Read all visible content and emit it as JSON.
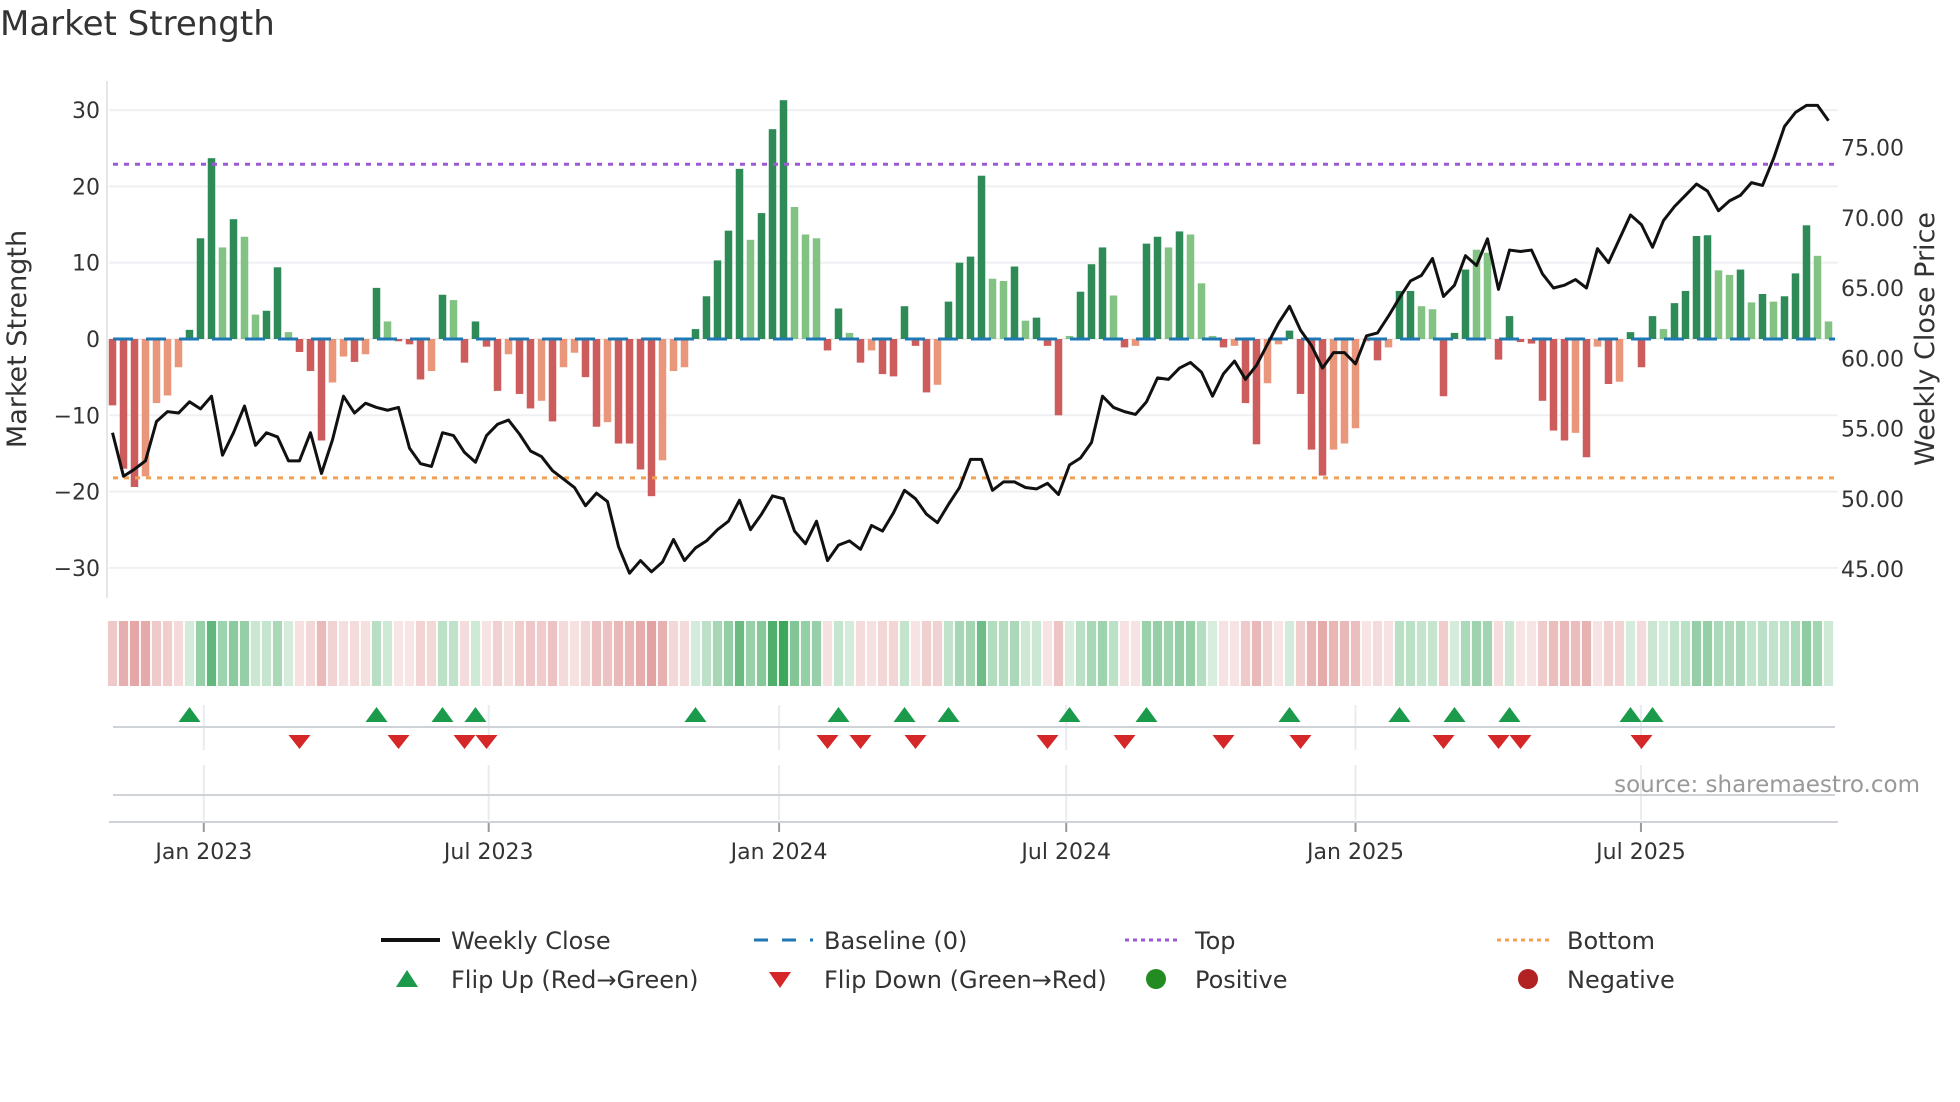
{
  "chart_data": {
    "type": "bar",
    "title": "Market Strength",
    "ylabel": "Market Strength",
    "y2label": "Weekly Close Price",
    "source": "source: sharemaestro.com",
    "ylim": [
      -33.8,
      33.8
    ],
    "y2lim": [
      42.9,
      79.7
    ],
    "yticks": [
      {
        "v": 30,
        "label": "30"
      },
      {
        "v": 20,
        "label": "20"
      },
      {
        "v": 10,
        "label": "10"
      },
      {
        "v": 0,
        "label": "0"
      },
      {
        "v": -10,
        "label": "−10"
      },
      {
        "v": -20,
        "label": "−20"
      },
      {
        "v": -30,
        "label": "−30"
      }
    ],
    "y2ticks": [
      {
        "v": 75,
        "label": "75.00"
      },
      {
        "v": 70,
        "label": "70.00"
      },
      {
        "v": 65,
        "label": "65.00"
      },
      {
        "v": 60,
        "label": "60.00"
      },
      {
        "v": 55,
        "label": "55.00"
      },
      {
        "v": 50,
        "label": "50.00"
      },
      {
        "v": 45,
        "label": "45.00"
      }
    ],
    "xticks": [
      {
        "week": 8.3,
        "label": "Jan 2023"
      },
      {
        "week": 34.2,
        "label": "Jul 2023"
      },
      {
        "week": 60.6,
        "label": "Jan 2024"
      },
      {
        "week": 86.7,
        "label": "Jul 2024"
      },
      {
        "week": 113.0,
        "label": "Jan 2025"
      },
      {
        "week": 138.95,
        "label": "Jul 2025"
      }
    ],
    "top": 22.9,
    "bottom": -18.2,
    "baseline": 0,
    "colors": {
      "G": "#2e8b57",
      "g": "#82c383",
      "R": "#cd5c5c",
      "r": "#e9967a",
      "top": "#9b59d6",
      "bottom": "#f0a050",
      "baseline": "#1f77b4",
      "close": "#111111",
      "flip_up": "#1a9a4a",
      "flip_down": "#d62728",
      "positive": "#228b22",
      "negative": "#b22222"
    },
    "bar_shade": "RRRrrrrGGGgGggGGgRRRrrRrGgRRRrGgRGRRrRRrRrrRRrRRRRrrrGGGGGgGGGgggRGgRrRRGRRrGGGGggGgGRRgGGGgRrGGgGgggRrRRrrGRRRrrrrRrGGggRGGggRGRRRRRrRrRrGRGgGGGGggGgGgGGGgg",
    "strength": [
      -8.7,
      -17,
      -19.4,
      -18,
      -8.4,
      -7.4,
      -3.7,
      1.2,
      13.2,
      23.7,
      12,
      15.7,
      13.4,
      3.2,
      3.7,
      9.4,
      0.9,
      -1.7,
      -4.2,
      -13.3,
      -5.7,
      -2.3,
      -3,
      -2,
      6.7,
      2.3,
      -0.3,
      -0.7,
      -5.3,
      -4.2,
      5.8,
      5.1,
      -3.1,
      2.3,
      -1,
      -6.8,
      -2,
      -7.2,
      -9.1,
      -8.1,
      -10.8,
      -3.7,
      -1.8,
      -5,
      -11.5,
      -10.9,
      -13.7,
      -13.7,
      -17.1,
      -20.6,
      -15.9,
      -4.2,
      -3.7,
      1.3,
      5.6,
      10.3,
      14.2,
      22.3,
      13,
      16.5,
      27.5,
      31.3,
      17.3,
      13.7,
      13.2,
      -1.5,
      4,
      0.8,
      -3.1,
      -1.5,
      -4.6,
      -4.9,
      4.3,
      -0.9,
      -7,
      -6,
      4.9,
      10,
      10.8,
      21.4,
      7.9,
      7.6,
      9.5,
      2.4,
      2.8,
      -0.9,
      -10,
      0.4,
      6.2,
      9.8,
      12,
      5.7,
      -1.1,
      -0.9,
      12.5,
      13.4,
      12,
      14.1,
      13.7,
      7.3,
      0.4,
      -1.1,
      -0.9,
      -8.4,
      -13.8,
      -5.8,
      -0.7,
      1.1,
      -7.2,
      -14.5,
      -17.9,
      -14.5,
      -13.7,
      -11.7,
      -0.3,
      -2.8,
      -1.1,
      6.3,
      6.3,
      4.3,
      3.9,
      -7.5,
      0.8,
      9.1,
      11.7,
      11.3,
      -2.7,
      3,
      -0.4,
      -0.6,
      -8.1,
      -12,
      -13.3,
      -12.3,
      -15.5,
      -1,
      -5.9,
      -5.6,
      0.9,
      -3.7,
      3,
      1.3,
      4.7,
      6.3,
      13.5,
      13.6,
      9,
      8.4,
      9.1,
      4.8,
      5.9,
      4.9,
      5.6,
      8.6,
      14.9,
      10.9,
      2.3
    ],
    "close": [
      54.7,
      51.6,
      52.1,
      52.7,
      55.5,
      56.2,
      56.1,
      56.9,
      56.4,
      57.3,
      53.1,
      54.7,
      56.6,
      53.8,
      54.7,
      54.4,
      52.7,
      52.7,
      54.7,
      51.8,
      54.2,
      57.3,
      56.1,
      56.8,
      56.5,
      56.3,
      56.5,
      53.6,
      52.5,
      52.3,
      54.7,
      54.5,
      53.3,
      52.6,
      54.5,
      55.3,
      55.6,
      54.6,
      53.4,
      53,
      52,
      51.4,
      50.8,
      49.5,
      50.4,
      49.8,
      46.6,
      44.7,
      45.6,
      44.8,
      45.5,
      47.1,
      45.6,
      46.5,
      47,
      47.8,
      48.4,
      49.9,
      47.8,
      48.9,
      50.2,
      50,
      47.7,
      46.8,
      48.4,
      45.6,
      46.7,
      47,
      46.4,
      48.1,
      47.7,
      49,
      50.6,
      50,
      48.9,
      48.3,
      49.6,
      50.8,
      52.8,
      52.8,
      50.6,
      51.2,
      51.2,
      50.8,
      50.7,
      51.1,
      50.3,
      52.4,
      52.9,
      54,
      57.3,
      56.5,
      56.2,
      56,
      56.9,
      58.6,
      58.5,
      59.3,
      59.7,
      59,
      57.3,
      58.9,
      59.8,
      58.5,
      59.5,
      61,
      62.5,
      63.7,
      62,
      60.9,
      59.3,
      60.4,
      60.4,
      59.6,
      61.6,
      61.8,
      63,
      64.3,
      65.5,
      65.9,
      67.1,
      64.4,
      65.2,
      67.3,
      66.6,
      68.5,
      64.9,
      67.7,
      67.6,
      67.7,
      66,
      65,
      65.2,
      65.6,
      65,
      67.8,
      66.8,
      68.5,
      70.2,
      69.5,
      67.9,
      69.8,
      70.8,
      71.6,
      72.4,
      71.9,
      70.5,
      71.2,
      71.6,
      72.5,
      72.3,
      74.2,
      76.5,
      77.5,
      78,
      78,
      76.9
    ],
    "legend": [
      {
        "key": "close",
        "label": "Weekly Close"
      },
      {
        "key": "baseline",
        "label": "Baseline (0)"
      },
      {
        "key": "top",
        "label": "Top"
      },
      {
        "key": "bottom",
        "label": "Bottom"
      },
      {
        "key": "flip_up",
        "label": "Flip Up (Red→Green)"
      },
      {
        "key": "flip_down",
        "label": "Flip Down (Green→Red)"
      },
      {
        "key": "positive",
        "label": "Positive"
      },
      {
        "key": "negative",
        "label": "Negative"
      }
    ],
    "legend_placement": "bottom"
  }
}
